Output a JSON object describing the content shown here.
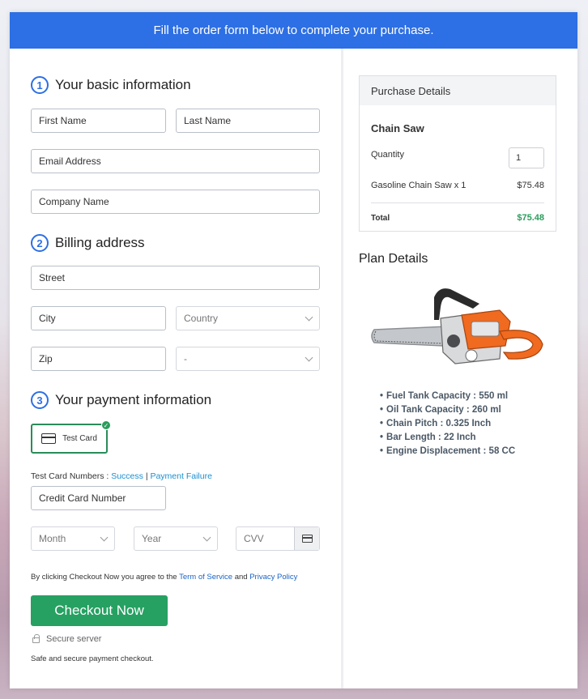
{
  "banner": "Fill the order form below to complete your purchase.",
  "section1": {
    "num": "1",
    "title": "Your basic information"
  },
  "section2": {
    "num": "2",
    "title": "Billing address"
  },
  "section3": {
    "num": "3",
    "title": "Your payment information"
  },
  "fields": {
    "first_name": "First Name",
    "last_name": "Last Name",
    "email": "Email Address",
    "company": "Company Name",
    "street": "Street",
    "city": "City",
    "country": "Country",
    "zip": "Zip",
    "state": "-",
    "card_number": "Credit Card Number",
    "month": "Month",
    "year": "Year",
    "cvv": "CVV"
  },
  "payment": {
    "test_card_label": "Test Card",
    "test_numbers_label": "Test Card Numbers :",
    "success_link": "Success",
    "separator": "|",
    "failure_link": "Payment Failure"
  },
  "terms": {
    "prefix": "By clicking Checkout Now you agree to the",
    "terms_link": "Term of Service",
    "and": "and",
    "privacy_link": "Privacy Policy"
  },
  "checkout_label": "Checkout Now",
  "secure_server": "Secure server",
  "secure_note": "Safe and secure payment checkout.",
  "purchase": {
    "heading": "Purchase Details",
    "product": "Chain Saw",
    "quantity_label": "Quantity",
    "quantity_value": "1",
    "line_item": "Gasoline Chain Saw x 1",
    "line_price": "$75.48",
    "total_label": "Total",
    "total_value": "$75.48"
  },
  "plan": {
    "heading": "Plan Details",
    "specs": [
      "Fuel Tank Capacity : 550 ml",
      "Oil Tank Capacity : 260 ml",
      "Chain Pitch : 0.325 Inch",
      "Bar Length : 22 Inch",
      "Engine Displacement : 58 CC"
    ]
  },
  "colors": {
    "banner": "#2d6fe4",
    "checkout": "#26a162",
    "total": "#2a9d5c",
    "link": "#1a8fd0"
  },
  "icons": [
    "card-icon",
    "check-icon",
    "chevron-down-icon",
    "lock-icon",
    "chainsaw-image"
  ]
}
